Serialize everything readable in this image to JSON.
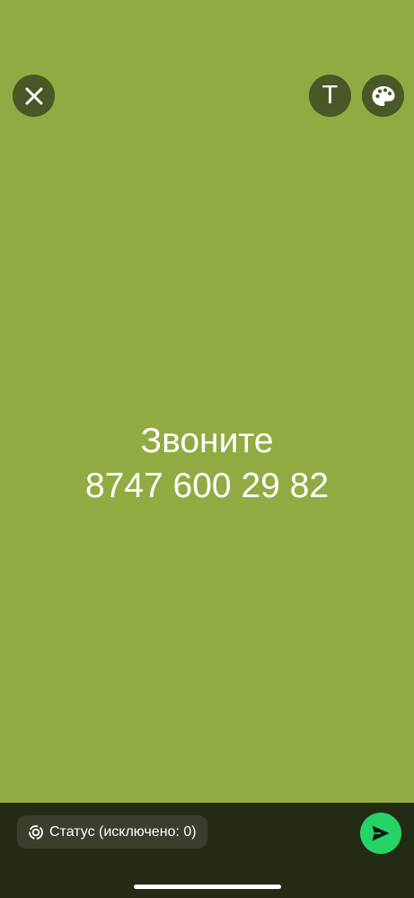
{
  "canvas": {
    "background_color": "#91ab42",
    "text_lines": [
      "Звоните",
      "8747 600 29 82"
    ]
  },
  "toolbar": {
    "close_icon": "close-icon",
    "text_tool_label": "T",
    "palette_icon": "palette-icon"
  },
  "bottom_bar": {
    "audience_label": "Статус (исключено: 0)",
    "audience_icon": "status-ring-icon",
    "send_icon": "send-icon",
    "send_color": "#25d366"
  }
}
